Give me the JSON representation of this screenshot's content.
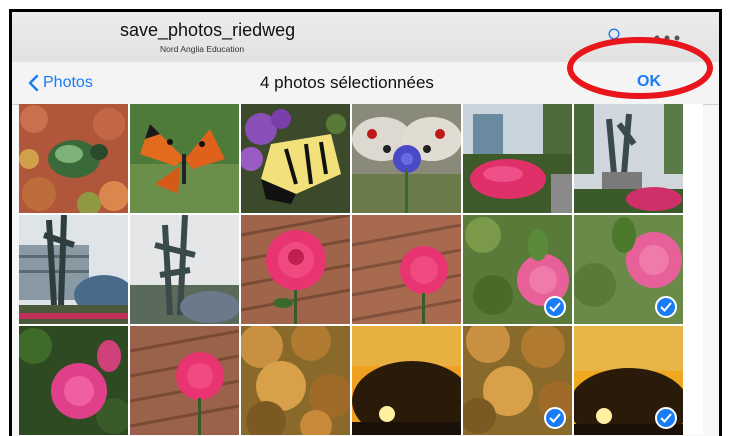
{
  "titlebar": {
    "title": "save_photos_riedweg",
    "subtitle": "Nord Anglia Education",
    "search_icon": "search-icon",
    "more_icon": "more-icon"
  },
  "navbar": {
    "back_label": "Photos",
    "title": "4 photos sélectionnées",
    "ok_label": "OK"
  },
  "annotation": {
    "color": "#e8151b",
    "shape": "ellipse around OK"
  },
  "colors": {
    "accent": "#1a7cf5"
  },
  "photos": [
    {
      "subject": "green beetle on succulents",
      "selected": false
    },
    {
      "subject": "orange butterfly",
      "selected": false
    },
    {
      "subject": "swallowtail butterfly on purple flowers",
      "selected": false
    },
    {
      "subject": "apollo butterfly",
      "selected": false
    },
    {
      "subject": "fountain and pink flower bed",
      "selected": false
    },
    {
      "subject": "statue and flower bed",
      "selected": false
    },
    {
      "subject": "sculpture in front of building",
      "selected": false
    },
    {
      "subject": "sculpture under cloudy sky",
      "selected": false
    },
    {
      "subject": "pink rose on wood",
      "selected": false
    },
    {
      "subject": "pink rose on wood",
      "selected": false
    },
    {
      "subject": "pink rose in garden",
      "selected": true
    },
    {
      "subject": "pink rose in garden",
      "selected": true
    },
    {
      "subject": "pink rose bush",
      "selected": false
    },
    {
      "subject": "pink rose on wood",
      "selected": false
    },
    {
      "subject": "autumn tree",
      "selected": false
    },
    {
      "subject": "sunset behind trees",
      "selected": false
    },
    {
      "subject": "autumn tree",
      "selected": true
    },
    {
      "subject": "sunset behind trees",
      "selected": true
    }
  ]
}
